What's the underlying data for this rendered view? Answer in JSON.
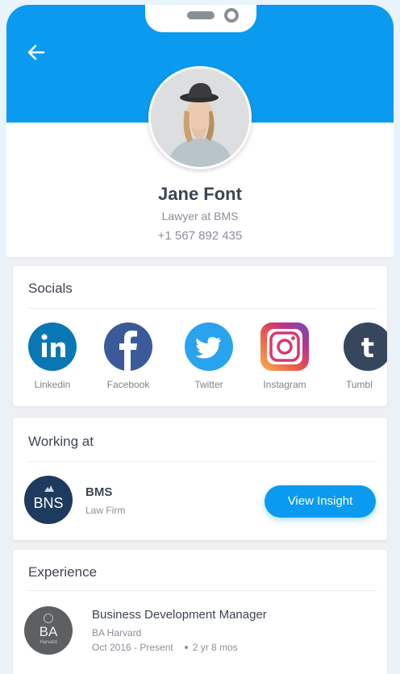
{
  "profile": {
    "name": "Jane Font",
    "role": "Lawyer at BMS",
    "phone": "+1 567 892 435"
  },
  "colors": {
    "header": "#0a9bf0",
    "accent_button": "#0a9bf0"
  },
  "socials": {
    "title": "Socials",
    "items": [
      {
        "label": "Linkedin",
        "icon": "linkedin-icon",
        "color": "#0a77b5"
      },
      {
        "label": "Facebook",
        "icon": "facebook-icon",
        "color": "#3b5a9a"
      },
      {
        "label": "Twitter",
        "icon": "twitter-icon",
        "color": "#2aa3ef"
      },
      {
        "label": "Instagram",
        "icon": "instagram-icon",
        "color": "#c13584"
      },
      {
        "label": "Tumbl",
        "icon": "tumblr-icon",
        "color": "#36465d"
      }
    ]
  },
  "working": {
    "title": "Working at",
    "company_logo": "BNS",
    "company_name": "BMS",
    "company_type": "Law Firm",
    "button_label": "View Insight"
  },
  "experience": {
    "title": "Experience",
    "logo_abbr": "BA",
    "logo_sub": "Harvard",
    "job_title": "Business Development Manager",
    "company": "BA Harvard",
    "dates": "Oct 2016 - Present",
    "duration": "2 yr 8 mos"
  }
}
